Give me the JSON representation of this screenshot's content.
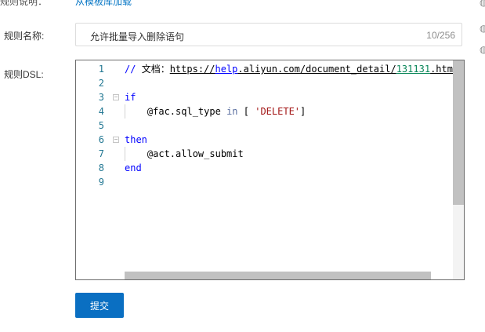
{
  "top_row": {
    "label": "规则说明：",
    "link": "从模板库加载"
  },
  "form": {
    "name_label": "规则名称:",
    "name_value": "允许批量导入删除语句",
    "name_counter": "10/256",
    "dsl_label": "规则DSL:"
  },
  "editor": {
    "line_numbers": [
      "1",
      "2",
      "3",
      "4",
      "5",
      "6",
      "7",
      "8",
      "9"
    ],
    "lines": {
      "l1": {
        "comment_prefix": "// ",
        "comment_text": "文档：",
        "url_scheme": "https://",
        "url_host": "help",
        "url_mid": ".aliyun.com/document_detail/",
        "url_num": "131131",
        "url_tail": ".html"
      },
      "l3": {
        "kw": "if"
      },
      "l4": {
        "var": "@fac.sql_type",
        "op": "in",
        "open": "[",
        "str": "'DELETE'",
        "close": "]"
      },
      "l6": {
        "kw": "then"
      },
      "l7": {
        "call": "@act.allow_submit"
      },
      "l8": {
        "kw": "end"
      }
    }
  },
  "actions": {
    "submit_label": "提交"
  },
  "colors": {
    "primary": "#0a6fc2",
    "link": "#0a78c6",
    "keyword": "#0000ff",
    "string": "#a31515",
    "line_number": "#237893"
  },
  "icons": [
    "info-icon",
    "info-icon",
    "info-icon",
    "fold-minus-icon"
  ]
}
